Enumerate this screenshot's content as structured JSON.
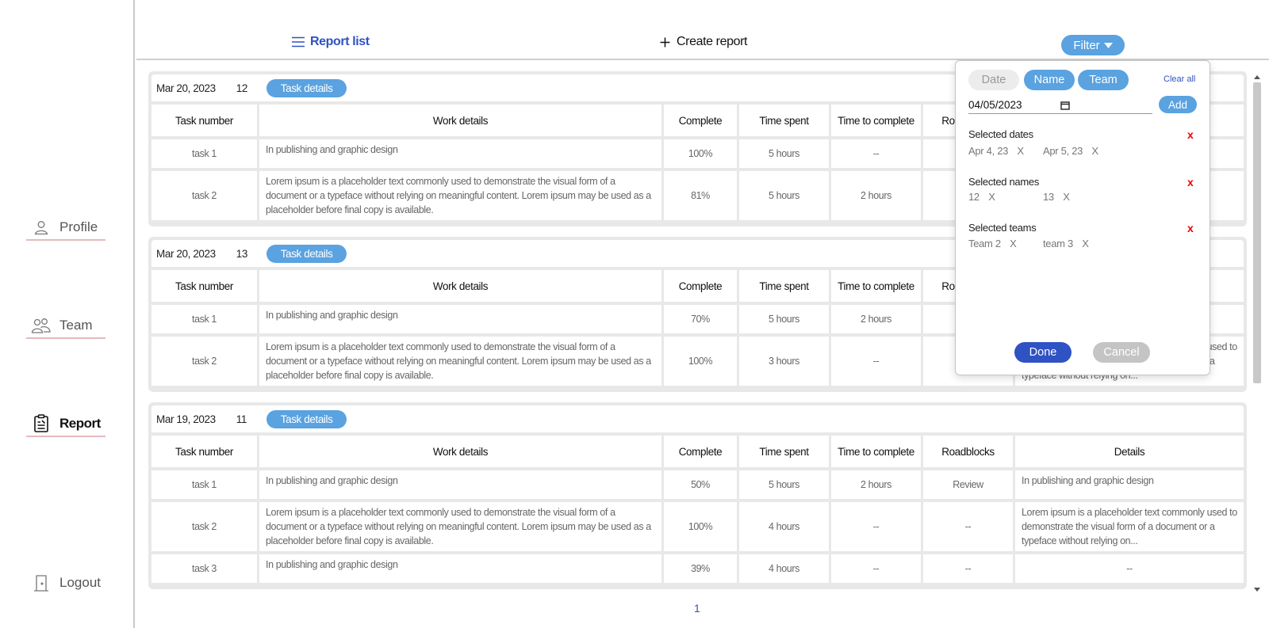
{
  "sidebar": {
    "items": [
      {
        "label": "Profile",
        "icon": "person-icon"
      },
      {
        "label": "Team",
        "icon": "team-icon"
      },
      {
        "label": "Report",
        "icon": "report-icon"
      },
      {
        "label": "Logout",
        "icon": "logout-icon"
      }
    ]
  },
  "topbar": {
    "report_list": "Report list",
    "create_report": "Create report",
    "filter": "Filter"
  },
  "table_headers": [
    "Task number",
    "Work details",
    "Complete",
    "Time spent",
    "Time to complete",
    "Roadblocks",
    "Details"
  ],
  "reports": [
    {
      "date": "Mar 20, 2023",
      "count": "12",
      "details_label": "Task details",
      "rows": [
        {
          "task": "task 1",
          "work": "In publishing and graphic design",
          "complete": "100%",
          "spent": "5 hours",
          "to_complete": "--",
          "roadblocks": "",
          "details": ""
        },
        {
          "task": "task 2",
          "work": "Lorem ipsum is a placeholder text commonly used to demonstrate the visual form of a document or a typeface without relying on meaningful content. Lorem ipsum may be used as a placeholder before final copy is available.",
          "complete": "81%",
          "spent": "5 hours",
          "to_complete": "2 hours",
          "roadblocks": "",
          "details": ""
        }
      ]
    },
    {
      "date": "Mar 20, 2023",
      "count": "13",
      "details_label": "Task details",
      "rows": [
        {
          "task": "task 1",
          "work": "In publishing and graphic design",
          "complete": "70%",
          "spent": "5 hours",
          "to_complete": "2 hours",
          "roadblocks": "",
          "details": ""
        },
        {
          "task": "task 2",
          "work": "Lorem ipsum is a placeholder text commonly used to demonstrate the visual form of a document or a typeface without relying on meaningful content. Lorem ipsum may be used as a placeholder before final copy is available.",
          "complete": "100%",
          "spent": "3 hours",
          "to_complete": "--",
          "roadblocks": "",
          "details": "Lorem ipsum is a placeholder text commonly used to demonstrate the visual form of a document or a typeface without relying on..."
        }
      ]
    },
    {
      "date": "Mar 19, 2023",
      "count": "11",
      "details_label": "Task details",
      "rows": [
        {
          "task": "task 1",
          "work": "In publishing and graphic design",
          "complete": "50%",
          "spent": "5 hours",
          "to_complete": "2 hours",
          "roadblocks": "Review",
          "details": "In publishing and graphic design"
        },
        {
          "task": "task 2",
          "work": "Lorem ipsum is a placeholder text commonly used to demonstrate the visual form of a document or a typeface without relying on meaningful content. Lorem ipsum may be used as a placeholder before final copy is available.",
          "complete": "100%",
          "spent": "4 hours",
          "to_complete": "--",
          "roadblocks": "--",
          "details": "Lorem ipsum is a placeholder text commonly used to demonstrate the visual form of a document or a typeface without relying on..."
        },
        {
          "task": "task 3",
          "work": "In publishing and graphic design",
          "complete": "39%",
          "spent": "4 hours",
          "to_complete": "--",
          "roadblocks": "--",
          "details": "--"
        }
      ]
    }
  ],
  "filter_panel": {
    "tabs": [
      "Date",
      "Name",
      "Team"
    ],
    "clear_all": "Clear all",
    "date_value": "04/05/2023",
    "add": "Add",
    "selected_dates_title": "Selected dates",
    "selected_dates": [
      "Apr 4, 23",
      "Apr 5, 23"
    ],
    "selected_names_title": "Selected names",
    "selected_names": [
      "12",
      "13"
    ],
    "selected_teams_title": "Selected teams",
    "selected_teams": [
      "Team 2",
      "team 3"
    ],
    "remove_mark": "X",
    "clear_section_mark": "x",
    "done": "Done",
    "cancel": "Cancel"
  },
  "pagination": {
    "current": "1"
  },
  "colors": {
    "accent": "#5aa2e0",
    "primary": "#2f52c4",
    "danger": "#e00000",
    "nav_underline": "#e4b9bd"
  }
}
